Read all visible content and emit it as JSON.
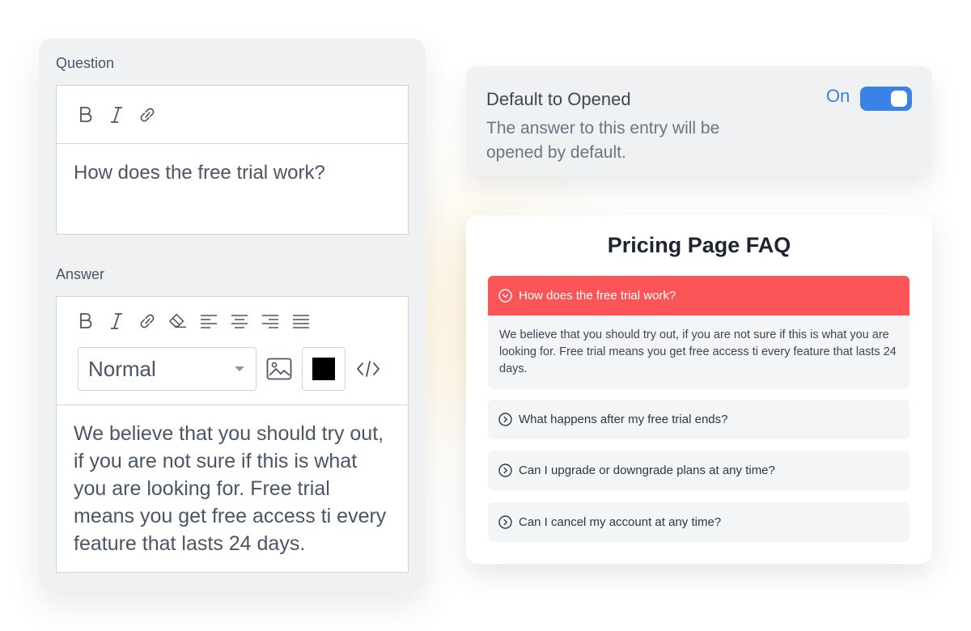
{
  "question_editor": {
    "label": "Question",
    "text": "How does the free trial work?"
  },
  "answer_editor": {
    "label": "Answer",
    "format_select_value": "Normal",
    "selected_color": "#000000",
    "text": "We believe that you should try out, if you are not sure if this is what you are looking for. Free trial means you get free access ti every feature that lasts 24 days."
  },
  "default_toggle": {
    "title": "Default to Opened",
    "description": "The answer to this entry will be opened by default.",
    "state_label": "On",
    "enabled": true,
    "accent_color": "#3b82e6"
  },
  "faq": {
    "title": "Pricing Page FAQ",
    "active_color": "#fb5558",
    "items": [
      {
        "question": "How does the free trial work?",
        "answer": "We believe that you should try out, if you are not sure if this is what you are looking for. Free trial means you get free access ti every feature that lasts 24 days.",
        "open": true
      },
      {
        "question": "What happens after my free trial ends?",
        "open": false
      },
      {
        "question": "Can I upgrade or downgrade plans at any time?",
        "open": false
      },
      {
        "question": "Can I cancel my account at any time?",
        "open": false
      }
    ]
  }
}
